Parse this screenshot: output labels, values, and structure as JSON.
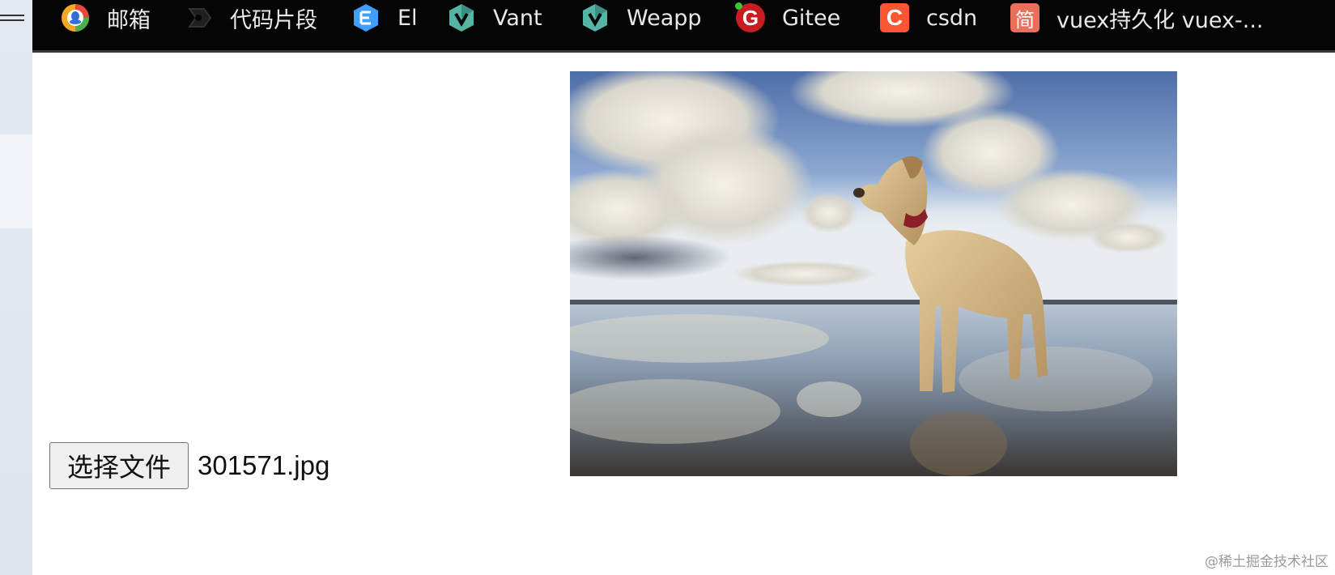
{
  "bookmarks": [
    {
      "label": "邮箱",
      "icon": "qq-mail-icon"
    },
    {
      "label": "代码片段",
      "icon": "code-snippet-icon"
    },
    {
      "label": "El",
      "icon": "element-ui-icon"
    },
    {
      "label": "Vant",
      "icon": "vant-icon"
    },
    {
      "label": "Weapp",
      "icon": "vant-weapp-icon"
    },
    {
      "label": "Gitee",
      "icon": "gitee-icon",
      "letter": "G"
    },
    {
      "label": "csdn",
      "icon": "csdn-icon",
      "letter": "C"
    },
    {
      "label": "vuex持久化 vuex-...",
      "icon": "jianshu-icon",
      "letter": "简"
    }
  ],
  "file_input": {
    "button_label": "选择文件",
    "file_name": "301571.jpg"
  },
  "preview": {
    "description_icon": "dog-on-beach-image"
  },
  "watermark": "@稀土掘金技术社区",
  "colors": {
    "bookmark_bar": "#050505",
    "gitee": "#c71d23",
    "csdn": "#fc5531",
    "jianshu": "#ea6f5a"
  }
}
